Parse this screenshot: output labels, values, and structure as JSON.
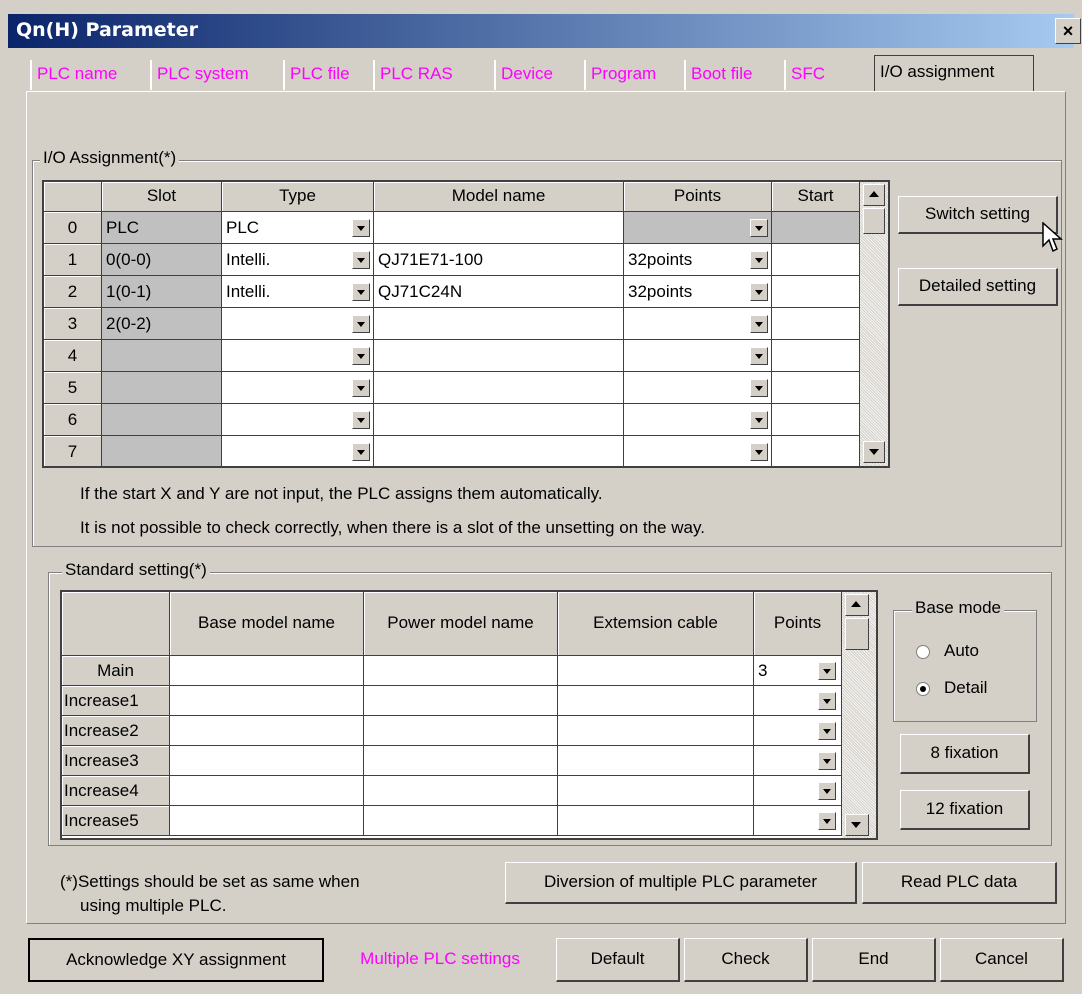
{
  "window": {
    "title": "Qn(H) Parameter",
    "close_label": "×"
  },
  "tabs": [
    "PLC name",
    "PLC system",
    "PLC file",
    "PLC RAS",
    "Device",
    "Program",
    "Boot file",
    "SFC",
    "I/O assignment"
  ],
  "active_tab": "I/O assignment",
  "io": {
    "legend": "I/O Assignment(*)",
    "columns": [
      "Slot",
      "Type",
      "Model name",
      "Points",
      "Start"
    ],
    "rows": [
      {
        "no": "0",
        "slot": "PLC",
        "type": "PLC",
        "model": "",
        "points": "",
        "start": ""
      },
      {
        "no": "1",
        "slot": "0(0-0)",
        "type": "Intelli.",
        "model": "QJ71E71-100",
        "points": "32points",
        "start": ""
      },
      {
        "no": "2",
        "slot": "1(0-1)",
        "type": "Intelli.",
        "model": "QJ71C24N",
        "points": "32points",
        "start": ""
      },
      {
        "no": "3",
        "slot": "2(0-2)",
        "type": "",
        "model": "",
        "points": "",
        "start": ""
      },
      {
        "no": "4",
        "slot": "",
        "type": "",
        "model": "",
        "points": "",
        "start": ""
      },
      {
        "no": "5",
        "slot": "",
        "type": "",
        "model": "",
        "points": "",
        "start": ""
      },
      {
        "no": "6",
        "slot": "",
        "type": "",
        "model": "",
        "points": "",
        "start": ""
      },
      {
        "no": "7",
        "slot": "",
        "type": "",
        "model": "",
        "points": "",
        "start": ""
      }
    ],
    "note1": "If the start X and Y are not input, the PLC assigns them automatically.",
    "note2": "It is not possible to check correctly, when there is a slot of the unsetting on the way.",
    "switch_setting": "Switch setting",
    "detailed_setting": "Detailed setting"
  },
  "standard": {
    "legend": "Standard setting(*)",
    "columns": [
      "Base model name",
      "Power model name",
      "Extemsion cable",
      "Points"
    ],
    "rows": [
      {
        "label": "Main",
        "base": "",
        "power": "",
        "cable": "",
        "points": "3"
      },
      {
        "label": "Increase1",
        "base": "",
        "power": "",
        "cable": "",
        "points": ""
      },
      {
        "label": "Increase2",
        "base": "",
        "power": "",
        "cable": "",
        "points": ""
      },
      {
        "label": "Increase3",
        "base": "",
        "power": "",
        "cable": "",
        "points": ""
      },
      {
        "label": "Increase4",
        "base": "",
        "power": "",
        "cable": "",
        "points": ""
      },
      {
        "label": "Increase5",
        "base": "",
        "power": "",
        "cable": "",
        "points": ""
      }
    ],
    "base_mode": {
      "legend": "Base mode",
      "options": [
        "Auto",
        "Detail"
      ],
      "selected": "Detail"
    },
    "fix8": "8 fixation",
    "fix12": "12 fixation"
  },
  "footnote": {
    "line1": "(*)Settings should be set as same when",
    "line2": "using multiple PLC."
  },
  "buttons": {
    "diversion": "Diversion of multiple PLC parameter",
    "read_plc": "Read PLC data",
    "ack_xy": "Acknowledge XY assignment",
    "multiple_plc": "Multiple PLC settings",
    "default": "Default",
    "check": "Check",
    "end": "End",
    "cancel": "Cancel"
  },
  "colors": {
    "tab_text": "#ff00ff",
    "title_bar": "#0a246a",
    "dialog_bg": "#d4d0c8"
  }
}
